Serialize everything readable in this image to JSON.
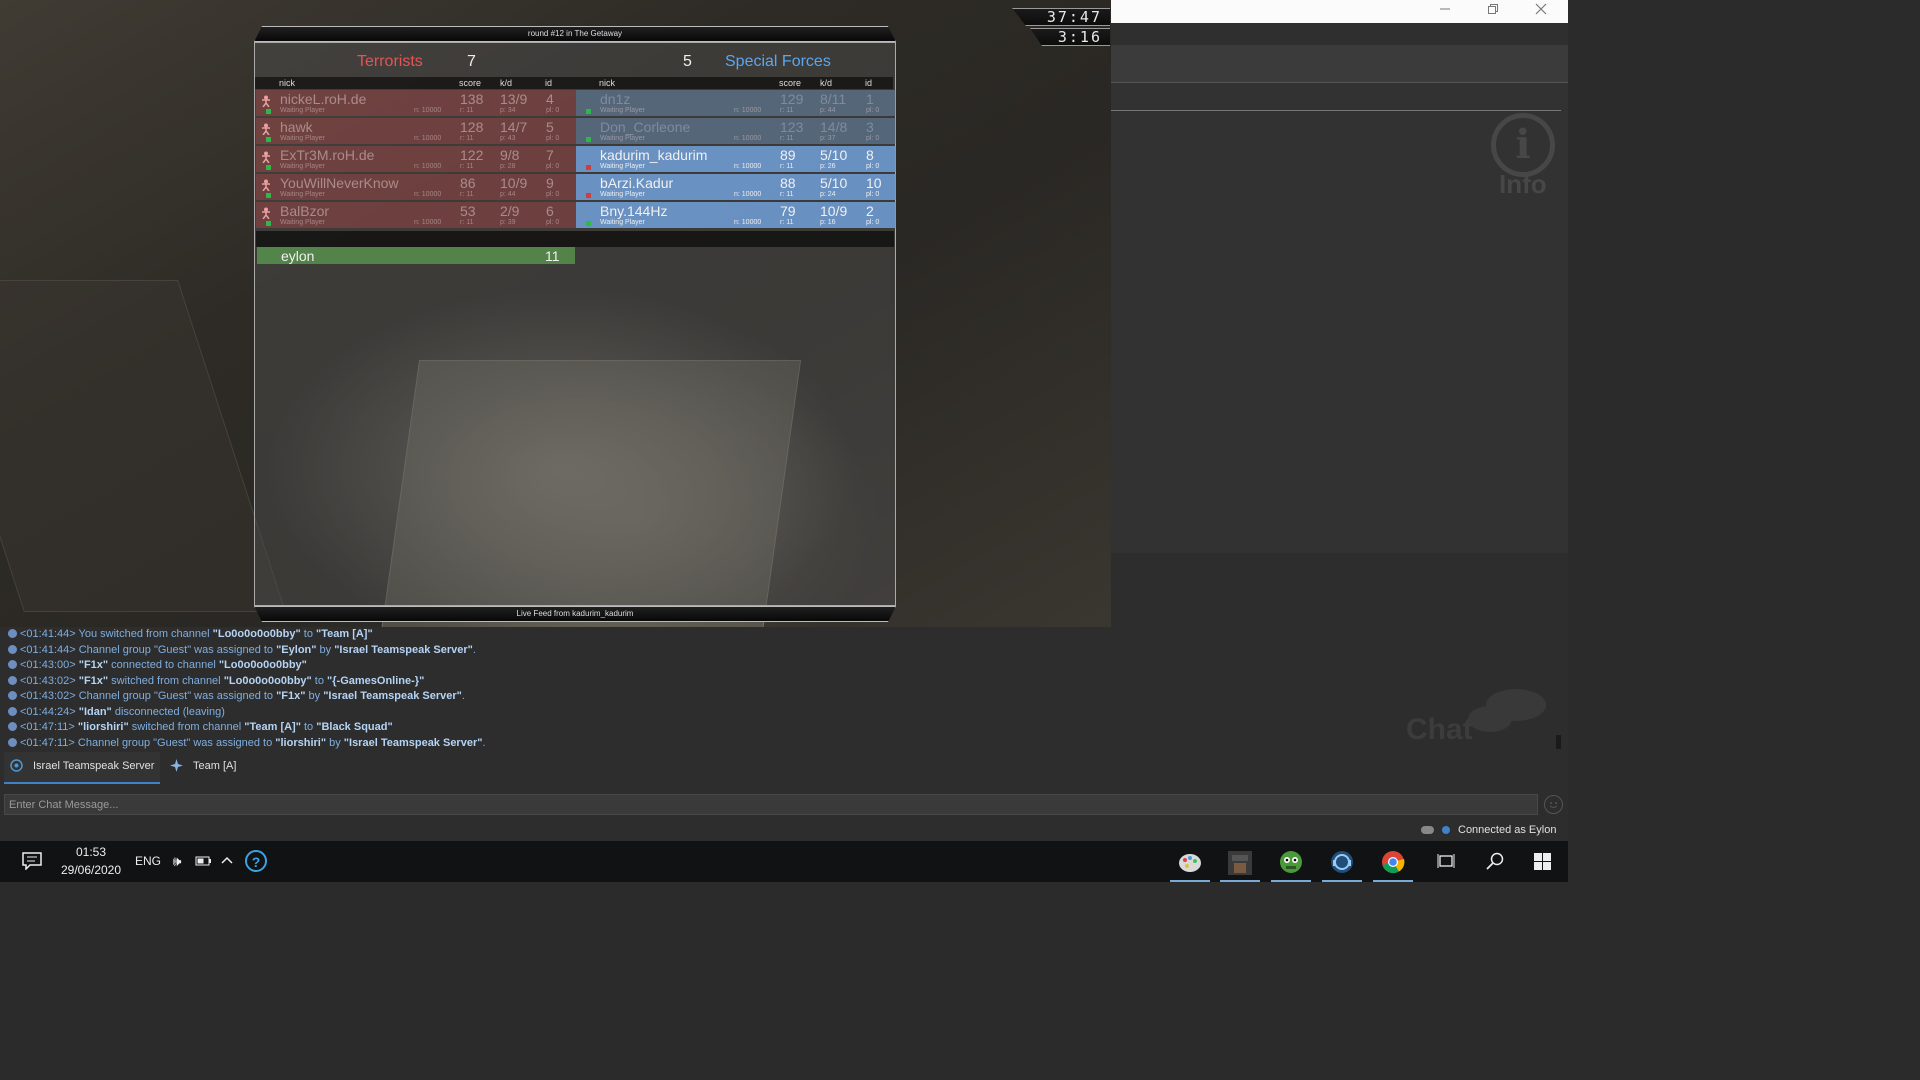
{
  "game": {
    "clock_main": "37:47",
    "clock_round": "3:16",
    "round_title": "round #12 in The Getaway",
    "live_feed": "Live Feed from kadurim_kadurim",
    "terrorists": {
      "name": "Terrorists",
      "score": "7"
    },
    "special_forces": {
      "name": "Special Forces",
      "score": "5"
    },
    "columns": {
      "nick": "nick",
      "score": "score",
      "kd": "k/d",
      "id": "id"
    },
    "t_rows": [
      {
        "nick": "nickeL.roH.de",
        "score": "138",
        "kd": "13/9",
        "id": "4",
        "status": "Waiting Player",
        "n": "n: 10000",
        "r": "r: 11",
        "p": "p: 34",
        "pl": "pl: 0"
      },
      {
        "nick": "hawk",
        "score": "128",
        "kd": "14/7",
        "id": "5",
        "status": "Waiting Player",
        "n": "n: 10000",
        "r": "r: 11",
        "p": "p: 43",
        "pl": "pl: 0"
      },
      {
        "nick": "ExTr3M.roH.de",
        "score": "122",
        "kd": "9/8",
        "id": "7",
        "status": "Waiting Player",
        "n": "n: 10000",
        "r": "r: 11",
        "p": "p: 28",
        "pl": "pl: 0"
      },
      {
        "nick": "YouWillNeverKnow",
        "score": "86",
        "kd": "10/9",
        "id": "9",
        "status": "Waiting Player",
        "n": "n: 10000",
        "r": "r: 11",
        "p": "p: 44",
        "pl": "pl: 0"
      },
      {
        "nick": "BalBzor",
        "score": "53",
        "kd": "2/9",
        "id": "6",
        "status": "Waiting Player",
        "n": "n: 10000",
        "r": "r: 11",
        "p": "p: 39",
        "pl": "pl: 0"
      }
    ],
    "ct_rows": [
      {
        "nick": "dn1z",
        "score": "129",
        "kd": "8/11",
        "id": "1",
        "status": "Waiting Player",
        "n": "n: 10000",
        "r": "r: 11",
        "p": "p: 44",
        "pl": "pl: 0"
      },
      {
        "nick": "Don_Corleone",
        "score": "123",
        "kd": "14/8",
        "id": "3",
        "status": "Waiting Player",
        "n": "n: 10000",
        "r": "r: 11",
        "p": "p: 37",
        "pl": "pl: 0"
      },
      {
        "nick": "kadurim_kadurim",
        "score": "89",
        "kd": "5/10",
        "id": "8",
        "status": "Waiting Player",
        "n": "n: 10000",
        "r": "r: 11",
        "p": "p: 26",
        "pl": "pl: 0"
      },
      {
        "nick": "bArzi.Kadur",
        "score": "88",
        "kd": "5/10",
        "id": "10",
        "status": "Waiting Player",
        "n": "n: 10000",
        "r": "r: 11",
        "p": "p: 24",
        "pl": "pl: 0"
      },
      {
        "nick": "Bny.144Hz",
        "score": "79",
        "kd": "10/9",
        "id": "2",
        "status": "Waiting Player",
        "n": "n: 10000",
        "r": "r: 11",
        "p": "p: 16",
        "pl": "pl: 0"
      }
    ],
    "spectator": {
      "nick": "eylon",
      "id": "11"
    }
  },
  "teamspeak": {
    "info_label": "Info",
    "chat_label": "Chat",
    "chat_lines": [
      [
        {
          "t": "<01:41:44> You switched from channel "
        },
        {
          "b": "\"Lo0o0o0o0bby\""
        },
        {
          "t": " to "
        },
        {
          "b": "\"Team [A]\""
        }
      ],
      [
        {
          "t": "<01:41:44> Channel group \"Guest\" was assigned to "
        },
        {
          "b": "\"Eylon\""
        },
        {
          "t": " by "
        },
        {
          "b": "\"Israel Teamspeak Server\""
        },
        {
          "t": "."
        }
      ],
      [
        {
          "t": "<01:43:00> "
        },
        {
          "b": "\"F1x\""
        },
        {
          "t": " connected to channel "
        },
        {
          "b": "\"Lo0o0o0o0bby\""
        }
      ],
      [
        {
          "t": "<01:43:02> "
        },
        {
          "b": "\"F1x\""
        },
        {
          "t": " switched from channel "
        },
        {
          "b": "\"Lo0o0o0o0bby\""
        },
        {
          "t": " to "
        },
        {
          "b": "\"{-GamesOnline-}\""
        }
      ],
      [
        {
          "t": "<01:43:02> Channel group \"Guest\" was assigned to "
        },
        {
          "b": "\"F1x\""
        },
        {
          "t": " by "
        },
        {
          "b": "\"Israel Teamspeak Server\""
        },
        {
          "t": "."
        }
      ],
      [
        {
          "t": "<01:44:24> "
        },
        {
          "b": "\"Idan\""
        },
        {
          "t": " disconnected (leaving)"
        }
      ],
      [
        {
          "t": "<01:47:11> "
        },
        {
          "b": "\"liorshiri\""
        },
        {
          "t": " switched from channel "
        },
        {
          "b": "\"Team [A]\""
        },
        {
          "t": " to "
        },
        {
          "b": "\"Black Squad\""
        }
      ],
      [
        {
          "t": "<01:47:11> Channel group \"Guest\" was assigned to "
        },
        {
          "b": "\"liorshiri\""
        },
        {
          "t": " by "
        },
        {
          "b": "\"Israel Teamspeak Server\""
        },
        {
          "t": "."
        }
      ]
    ],
    "tabs": {
      "server": "Israel Teamspeak Server",
      "team": "Team [A]"
    },
    "input_placeholder": "Enter Chat Message...",
    "status": "Connected as Eylon"
  },
  "taskbar": {
    "time": "01:53",
    "date": "29/06/2020",
    "language": "ENG"
  }
}
